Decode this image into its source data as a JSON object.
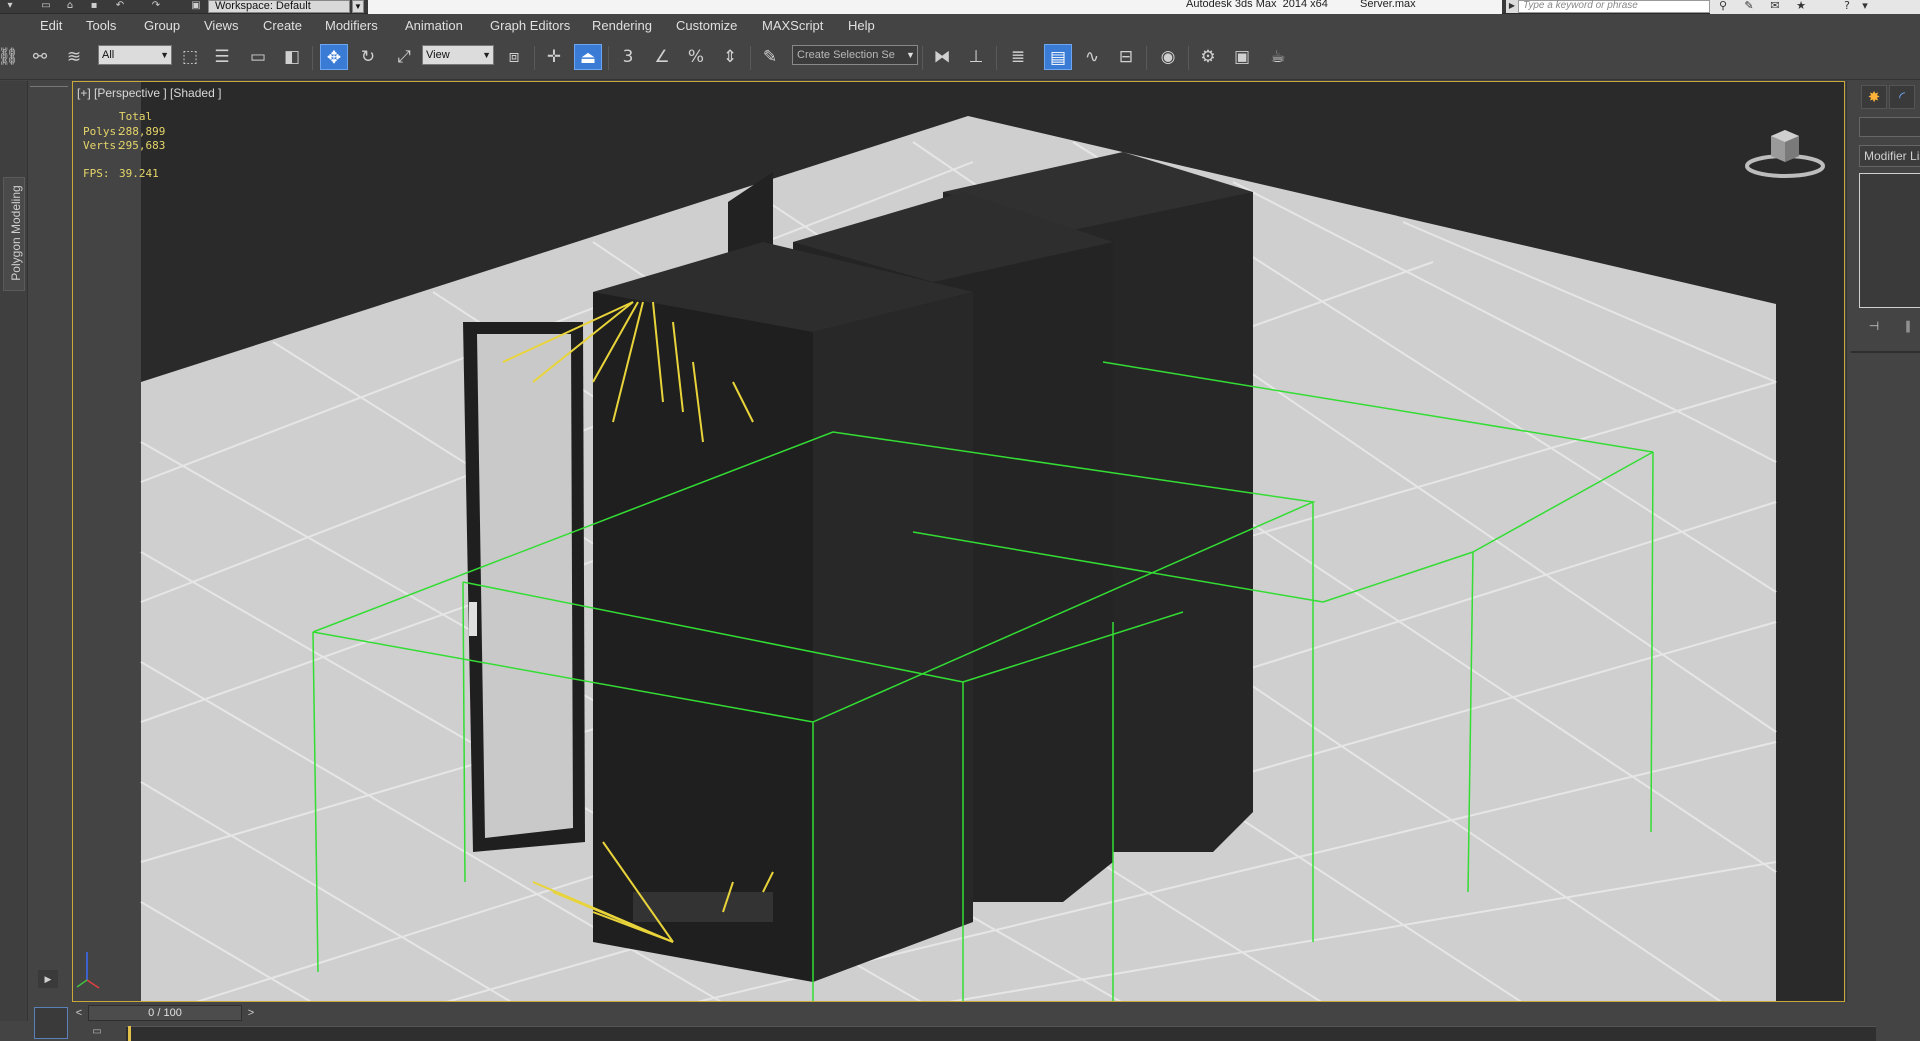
{
  "window": {
    "workspace": "Workspace: Default",
    "app_title": "Autodesk 3ds Max  2014 x64",
    "file_name": "Server.max",
    "search_placeholder": "Type a keyword or phrase"
  },
  "menu": [
    "Edit",
    "Tools",
    "Group",
    "Views",
    "Create",
    "Modifiers",
    "Animation",
    "Graph Editors",
    "Rendering",
    "Customize",
    "MAXScript",
    "Help"
  ],
  "toolbar": {
    "selection_filter": "All",
    "reference_coord": "View",
    "selection_set_placeholder": "Create Selection Se",
    "snap_label": "3",
    "accent_color": "#3a7bd5"
  },
  "ribbon": {
    "tab_label": "Polygon Modeling"
  },
  "viewport": {
    "label": "[+] [Perspective ] [Shaded ]",
    "stats": {
      "total_label": "Total",
      "polys_label": "Polys:",
      "polys_value": "288,899",
      "verts_label": "Verts:",
      "verts_value": "295,683",
      "fps_label": "FPS:",
      "fps_value": "39.241"
    },
    "selection_color": "#33dd33",
    "active_border_color": "#c8a93a"
  },
  "command_panel": {
    "modifier_list_label": "Modifier List"
  },
  "timeline": {
    "frame_display": "0 / 100",
    "prev": "<",
    "next": ">"
  }
}
